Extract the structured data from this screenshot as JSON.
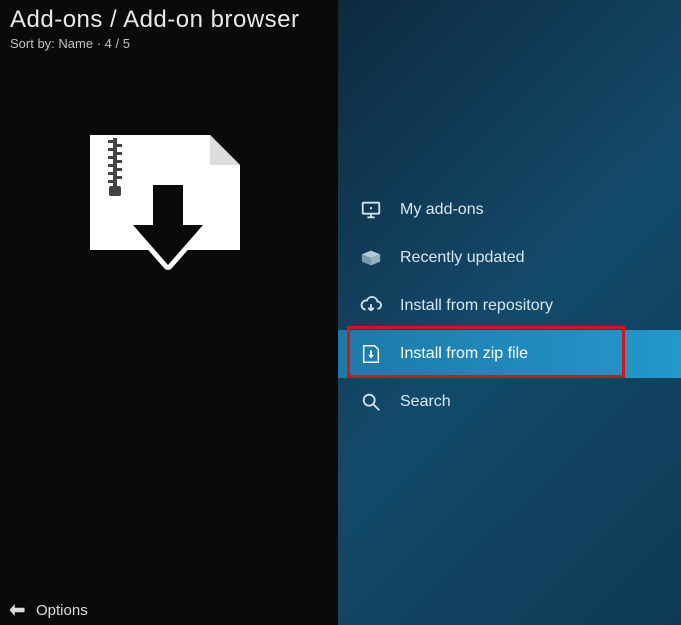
{
  "header": {
    "breadcrumb": "Add-ons / Add-on browser",
    "sort_prefix": "Sort by: ",
    "sort_value": "Name",
    "sort_sep": "  ·  ",
    "position": "4 / 5"
  },
  "menu": {
    "items": [
      {
        "label": "My add-ons",
        "icon": "monitor-icon"
      },
      {
        "label": "Recently updated",
        "icon": "box-open-icon"
      },
      {
        "label": "Install from repository",
        "icon": "cloud-download-icon"
      },
      {
        "label": "Install from zip file",
        "icon": "zip-install-icon"
      },
      {
        "label": "Search",
        "icon": "search-icon"
      }
    ],
    "selected_index": 3
  },
  "footer": {
    "options_label": "Options"
  }
}
